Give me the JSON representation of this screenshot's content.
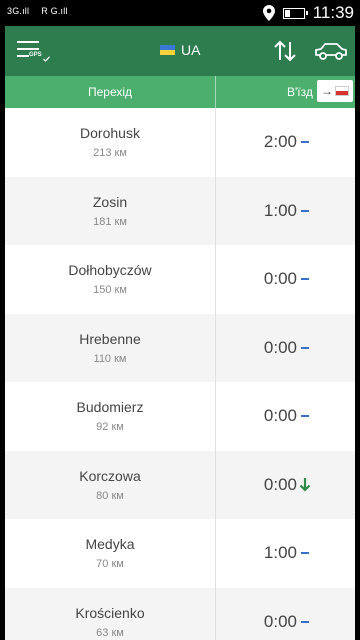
{
  "status_bar": {
    "sim1": "3G.ıll",
    "sim2": "R G.ıll",
    "time": "11:39"
  },
  "app_bar": {
    "menu_sub": "GPS",
    "country_code": "UA",
    "brand_color": "#2e7d4f"
  },
  "table_header": {
    "crossing_label": "Перехід",
    "entry_label": "В'їзд",
    "direction_arrow": "→"
  },
  "rows": [
    {
      "name": "Dorohusk",
      "distance": "213 км",
      "time": "2:00",
      "trend": "flat"
    },
    {
      "name": "Zosin",
      "distance": "181 км",
      "time": "1:00",
      "trend": "flat"
    },
    {
      "name": "Dołhobyczów",
      "distance": "150 км",
      "time": "0:00",
      "trend": "flat"
    },
    {
      "name": "Hrebenne",
      "distance": "110 км",
      "time": "0:00",
      "trend": "flat"
    },
    {
      "name": "Budomierz",
      "distance": "92 км",
      "time": "0:00",
      "trend": "flat"
    },
    {
      "name": "Korczowa",
      "distance": "80 км",
      "time": "0:00",
      "trend": "down"
    },
    {
      "name": "Medyka",
      "distance": "70 км",
      "time": "1:00",
      "trend": "flat"
    },
    {
      "name": "Krościenko",
      "distance": "63 км",
      "time": "0:00",
      "trend": "flat"
    }
  ]
}
